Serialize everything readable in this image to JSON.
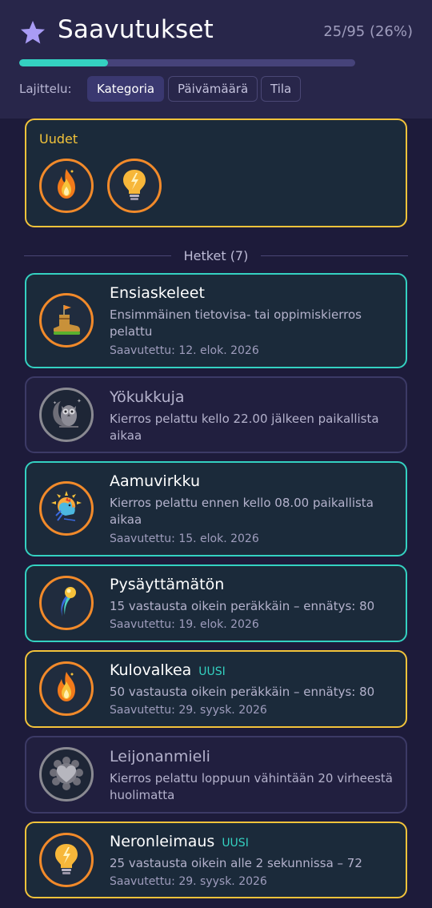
{
  "header": {
    "title": "Saavutukset",
    "progress_text": "25/95 (26%)",
    "progress_fraction": 0.2632,
    "sort_label": "Lajittelu:",
    "sort_options": [
      "Kategoria",
      "Päivämäärä",
      "Tila"
    ],
    "sort_selected": "Kategoria"
  },
  "new_section": {
    "title": "Uudet",
    "icons": [
      "flame-icon",
      "lightbulb-icon"
    ]
  },
  "category": {
    "label": "Hetket (7)"
  },
  "achievements": [
    {
      "title": "Ensiaskeleet",
      "badge": "",
      "description": "Ensimmäinen tietovisa- tai oppimiskierros pelattu",
      "date": "Saavutettu: 12. elok. 2026",
      "icon": "boot-flag-icon",
      "state": "unlocked"
    },
    {
      "title": "Yökukkuja",
      "badge": "",
      "description": "Kierros pelattu kello 22.00 jälkeen paikallista aikaa",
      "date": "",
      "icon": "owl-moon-icon",
      "state": "locked"
    },
    {
      "title": "Aamuvirkku",
      "badge": "",
      "description": "Kierros pelattu ennen kello 08.00 paikallista aikaa",
      "date": "Saavutettu: 15. elok. 2026",
      "icon": "rooster-sun-icon",
      "state": "unlocked"
    },
    {
      "title": "Pysäyttämätön",
      "badge": "",
      "description": "15 vastausta oikein peräkkäin – ennätys: 80",
      "date": "Saavutettu: 19. elok. 2026",
      "icon": "comet-icon",
      "state": "unlocked"
    },
    {
      "title": "Kulovalkea",
      "badge": "UUSI",
      "description": "50 vastausta oikein peräkkäin – ennätys: 80",
      "date": "Saavutettu: 29. syysk. 2026",
      "icon": "flame-icon",
      "state": "new"
    },
    {
      "title": "Leijonanmieli",
      "badge": "",
      "description": "Kierros pelattu loppuun vähintään 20 virheestä huolimatta",
      "date": "",
      "icon": "lion-heart-icon",
      "state": "locked"
    },
    {
      "title": "Neronleimaus",
      "badge": "UUSI",
      "description": "25 vastausta oikein alle 2 sekunnissa – 72",
      "date": "Saavutettu: 29. syysk. 2026",
      "icon": "lightbulb-icon",
      "state": "new"
    }
  ],
  "colors": {
    "background": "#1d1b3a",
    "header": "#28264a",
    "accent_teal": "#34d1c1",
    "accent_gold": "#f2c33a",
    "medal_ring": "#f28a2a"
  }
}
